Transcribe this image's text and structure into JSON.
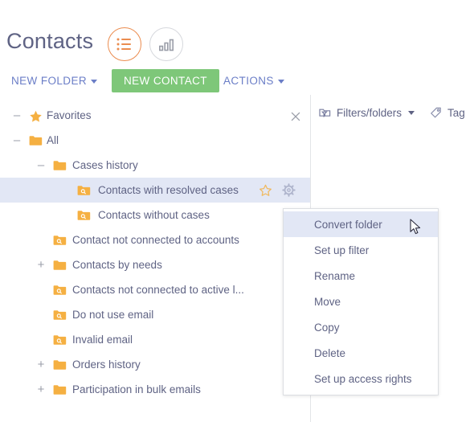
{
  "header": {
    "title": "Contacts",
    "view_toggles": [
      {
        "name": "list-view",
        "icon": "list-icon",
        "active": true
      },
      {
        "name": "chart-view",
        "icon": "bar-chart-icon",
        "active": false
      }
    ]
  },
  "action_bar": {
    "new_folder_label": "NEW FOLDER",
    "new_contact_label": "NEW CONTACT",
    "actions_label": "ACTIONS"
  },
  "tree": {
    "close_icon": "close-icon",
    "items": [
      {
        "label": "Favorites",
        "icon": "star-icon",
        "expander": "minus",
        "depth": 0
      },
      {
        "label": "All",
        "icon": "folder-icon",
        "expander": "minus",
        "depth": 0
      },
      {
        "label": "Cases history",
        "icon": "folder-icon",
        "expander": "minus",
        "depth": 1
      },
      {
        "label": "Contacts with resolved cases",
        "icon": "folder-search-icon",
        "expander": "",
        "depth": 2,
        "selected": true,
        "tools": [
          "favorite-star-icon",
          "gear-icon"
        ]
      },
      {
        "label": "Contacts without cases",
        "icon": "folder-search-icon",
        "expander": "",
        "depth": 2
      },
      {
        "label": "Contact not connected to accounts",
        "icon": "folder-search-icon",
        "expander": "",
        "depth": 1
      },
      {
        "label": "Contacts by needs",
        "icon": "folder-icon",
        "expander": "plus",
        "depth": 1
      },
      {
        "label": "Contacts not connected to active l...",
        "icon": "folder-search-icon",
        "expander": "",
        "depth": 1
      },
      {
        "label": "Do not use email",
        "icon": "folder-search-icon",
        "expander": "",
        "depth": 1
      },
      {
        "label": "Invalid email",
        "icon": "folder-search-icon",
        "expander": "",
        "depth": 1
      },
      {
        "label": "Orders history",
        "icon": "folder-icon",
        "expander": "plus",
        "depth": 1
      },
      {
        "label": "Participation in bulk emails",
        "icon": "folder-icon",
        "expander": "plus",
        "depth": 1
      }
    ]
  },
  "right_toolbar": {
    "filters_label": "Filters/folders",
    "filters_icon": "filter-folder-icon",
    "tag_label": "Tag",
    "tag_icon": "tag-icon"
  },
  "context_menu": {
    "items": [
      {
        "label": "Convert folder",
        "highlight": true
      },
      {
        "label": "Set up filter"
      },
      {
        "label": "Rename"
      },
      {
        "label": "Move"
      },
      {
        "label": "Copy"
      },
      {
        "label": "Delete"
      },
      {
        "label": "Set up access rights"
      }
    ]
  },
  "colors": {
    "accent_orange": "#eb8c4f",
    "accent_green": "#7ec779",
    "link_blue": "#6b7ec7",
    "text": "#5f6384",
    "folder_orange": "#f5b042",
    "selection": "#e2e7f5"
  }
}
